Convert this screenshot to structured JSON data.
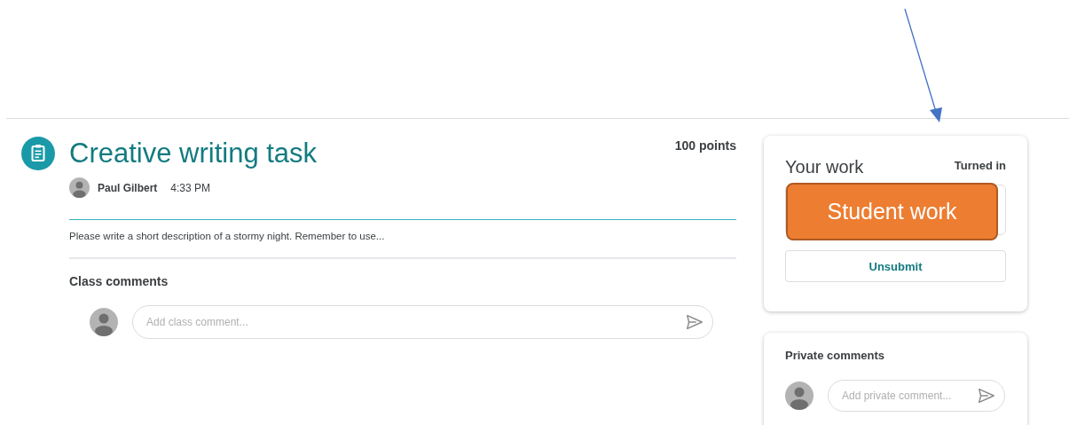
{
  "assignment": {
    "title": "Creative writing task",
    "points": "100 points",
    "author": "Paul Gilbert",
    "time": "4:33 PM",
    "description": "Please write a short description of a stormy night. Remember to use..."
  },
  "class_comments": {
    "heading": "Class comments",
    "placeholder": "Add class comment..."
  },
  "your_work": {
    "heading": "Your work",
    "status": "Turned in",
    "callout": "Student work",
    "button": "Unsubmit"
  },
  "private_comments": {
    "heading": "Private comments",
    "placeholder": "Add private comment..."
  }
}
